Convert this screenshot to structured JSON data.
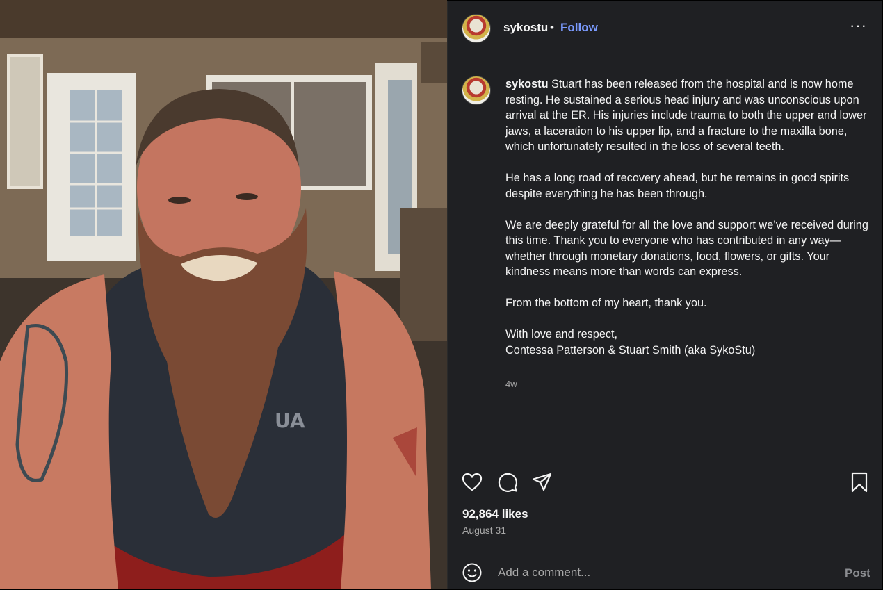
{
  "post": {
    "username": "sykostu",
    "separator": "•",
    "follow_label": "Follow",
    "more_icon": "more-horizontal-icon",
    "more_label": "···"
  },
  "caption": {
    "username": "sykostu",
    "paragraphs": [
      "Stuart has been released from the hospital and is now home resting. He sustained a serious head injury and was unconscious upon arrival at the ER. His injuries include trauma to both the upper and lower jaws, a laceration to his upper lip, and a fracture to the maxilla bone, which unfortunately resulted in the loss of several teeth.",
      "He has a long road of recovery ahead, but he remains in good spirits despite everything he has been through.",
      "We are deeply grateful for all the love and support we’ve received during this time. Thank you to everyone who has contributed in any way—whether through monetary donations, food, flowers, or gifts. Your kindness means more than words can express.",
      "From the bottom of my heart, thank you.",
      "With love and respect,",
      "Contessa Patterson & Stuart Smith (aka SykoStu)"
    ],
    "age": "4w"
  },
  "actions": {
    "icons": [
      "heart-icon",
      "comment-icon",
      "share-icon",
      "bookmark-icon"
    ]
  },
  "stats": {
    "likes": "92,864 likes",
    "date": "August 31"
  },
  "comment": {
    "placeholder": "Add a comment...",
    "post_label": "Post",
    "emoji_icon": "emoji-icon"
  },
  "colors": {
    "panel_bg": "#1f2023",
    "link": "#7b9bff",
    "muted": "#a8a8a8",
    "text": "#f5f5f5"
  }
}
